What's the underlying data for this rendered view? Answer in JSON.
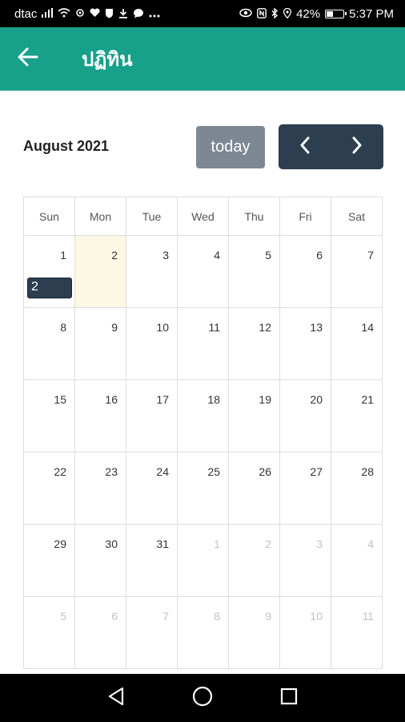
{
  "status_bar": {
    "carrier": "dtac",
    "battery": "42%",
    "battery_level": 0.42,
    "time": "5:37 PM",
    "left_icons": [
      "signal-icon",
      "wifi-icon",
      "location-icon",
      "heart-icon",
      "shield-icon",
      "download-icon",
      "chat-icon",
      "more-icon"
    ],
    "right_icons": [
      "eye-icon",
      "nfc-icon",
      "bluetooth-icon",
      "location-pin-icon",
      "battery-icon"
    ]
  },
  "app_bar": {
    "title": "ปฏิทิน",
    "color": "#17a08a"
  },
  "toolbar": {
    "month_title": "August 2021",
    "today_label": "today",
    "prev_icon": "chevron-left-icon",
    "next_icon": "chevron-right-icon"
  },
  "calendar": {
    "weekdays": [
      "Sun",
      "Mon",
      "Tue",
      "Wed",
      "Thu",
      "Fri",
      "Sat"
    ],
    "weeks": [
      [
        "1",
        "2",
        "3",
        "4",
        "5",
        "6",
        "7"
      ],
      [
        "8",
        "9",
        "10",
        "11",
        "12",
        "13",
        "14"
      ],
      [
        "15",
        "16",
        "17",
        "18",
        "19",
        "20",
        "21"
      ],
      [
        "22",
        "23",
        "24",
        "25",
        "26",
        "27",
        "28"
      ],
      [
        "29",
        "30",
        "31",
        "1",
        "2",
        "3",
        "4"
      ],
      [
        "5",
        "6",
        "7",
        "8",
        "9",
        "10",
        "11"
      ]
    ],
    "today_highlight_color": "#fcf8e3",
    "event": {
      "label": "2",
      "color": "#2c3e50"
    }
  },
  "nav_bar": {
    "icons": [
      "back-triangle-icon",
      "home-circle-icon",
      "recents-square-icon"
    ]
  }
}
